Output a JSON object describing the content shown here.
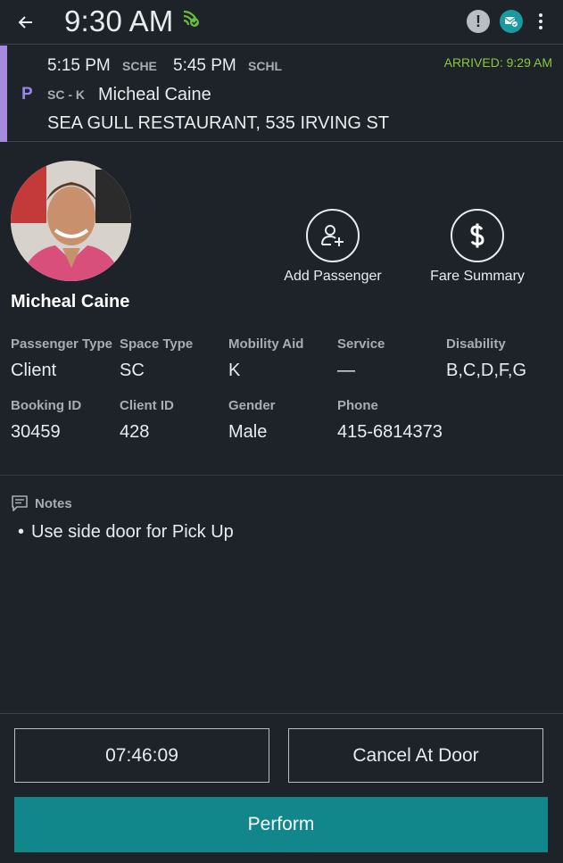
{
  "status_bar": {
    "time": "9:30 AM"
  },
  "trip": {
    "pickup_time": "5:15 PM",
    "pickup_label": "SCHE",
    "dropoff_time": "5:45 PM",
    "dropoff_label": "SCHL",
    "status": "ARRIVED: 9:29 AM",
    "type_letter": "P",
    "space_code": "SC - K",
    "passenger_name": "Micheal Caine",
    "address": "SEA GULL RESTAURANT, 535 IRVING ST",
    "accent_color": "#a58ae0"
  },
  "actions": {
    "add_passenger": "Add Passenger",
    "fare_summary": "Fare Summary"
  },
  "passenger": {
    "name": "Micheal Caine",
    "fields": [
      {
        "label": "Passenger Type",
        "value": "Client"
      },
      {
        "label": "Space Type",
        "value": "SC"
      },
      {
        "label": "Mobility Aid",
        "value": "K"
      },
      {
        "label": "Service",
        "value": "—"
      },
      {
        "label": "Disability",
        "value": "B,C,D,F,G"
      },
      {
        "label": "Booking ID",
        "value": "30459"
      },
      {
        "label": "Client ID",
        "value": "428"
      },
      {
        "label": "Gender",
        "value": "Male"
      },
      {
        "label": "Phone",
        "value": "415-6814373"
      }
    ]
  },
  "notes": {
    "title": "Notes",
    "items": [
      "Use side door for Pick Up"
    ]
  },
  "buttons": {
    "timer": "07:46:09",
    "cancel": "Cancel At Door",
    "perform": "Perform"
  },
  "colors": {
    "background": "#1e232a",
    "primary": "#12878b",
    "arrived": "#8cc63f"
  }
}
